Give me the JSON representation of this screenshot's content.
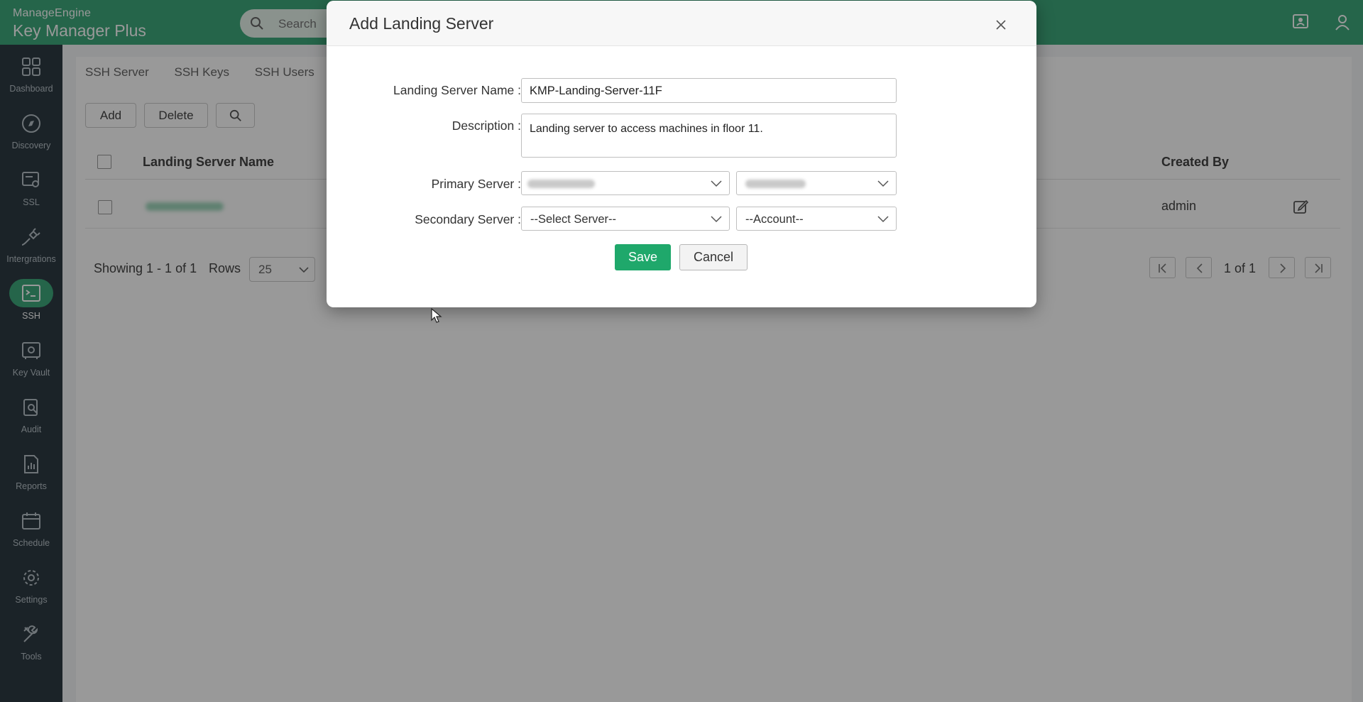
{
  "brand": {
    "vendor": "ManageEngine",
    "product": "Key Manager Plus"
  },
  "search": {
    "placeholder": "Search"
  },
  "sidebar": {
    "items": [
      {
        "label": "Dashboard",
        "icon": "dashboard-icon"
      },
      {
        "label": "Discovery",
        "icon": "compass-icon"
      },
      {
        "label": "SSL",
        "icon": "certificate-icon"
      },
      {
        "label": "Intergrations",
        "icon": "plug-icon"
      },
      {
        "label": "SSH",
        "icon": "terminal-icon",
        "active": true
      },
      {
        "label": "Key Vault",
        "icon": "vault-icon"
      },
      {
        "label": "Audit",
        "icon": "audit-icon"
      },
      {
        "label": "Reports",
        "icon": "reports-icon"
      },
      {
        "label": "Schedule",
        "icon": "calendar-icon"
      },
      {
        "label": "Settings",
        "icon": "gear-icon"
      },
      {
        "label": "Tools",
        "icon": "tools-icon"
      }
    ]
  },
  "tabs": [
    "SSH Server",
    "SSH Keys",
    "SSH Users"
  ],
  "toolbar": {
    "add_label": "Add",
    "delete_label": "Delete"
  },
  "table": {
    "columns": {
      "name": "Landing Server Name",
      "created_by": "Created By"
    },
    "rows": [
      {
        "created_by": "admin"
      }
    ]
  },
  "footer": {
    "showing": "Showing 1 - 1 of 1",
    "rows_label": "Rows",
    "rows_value": "25",
    "page_info": "1 of 1"
  },
  "modal": {
    "title": "Add Landing Server",
    "fields": {
      "name_label": "Landing Server Name",
      "name_value": "KMP-Landing-Server-11F",
      "description_label": "Description",
      "description_value": "Landing server to access machines in floor 11.",
      "primary_label": "Primary Server",
      "secondary_label": "Secondary Server",
      "secondary_server_value": "--Select Server--",
      "secondary_account_value": "--Account--"
    },
    "save_label": "Save",
    "cancel_label": "Cancel"
  },
  "colors": {
    "brand_green": "#3ea87c",
    "save_green": "#1fa86b",
    "sidebar_bg": "#2e3b44"
  }
}
